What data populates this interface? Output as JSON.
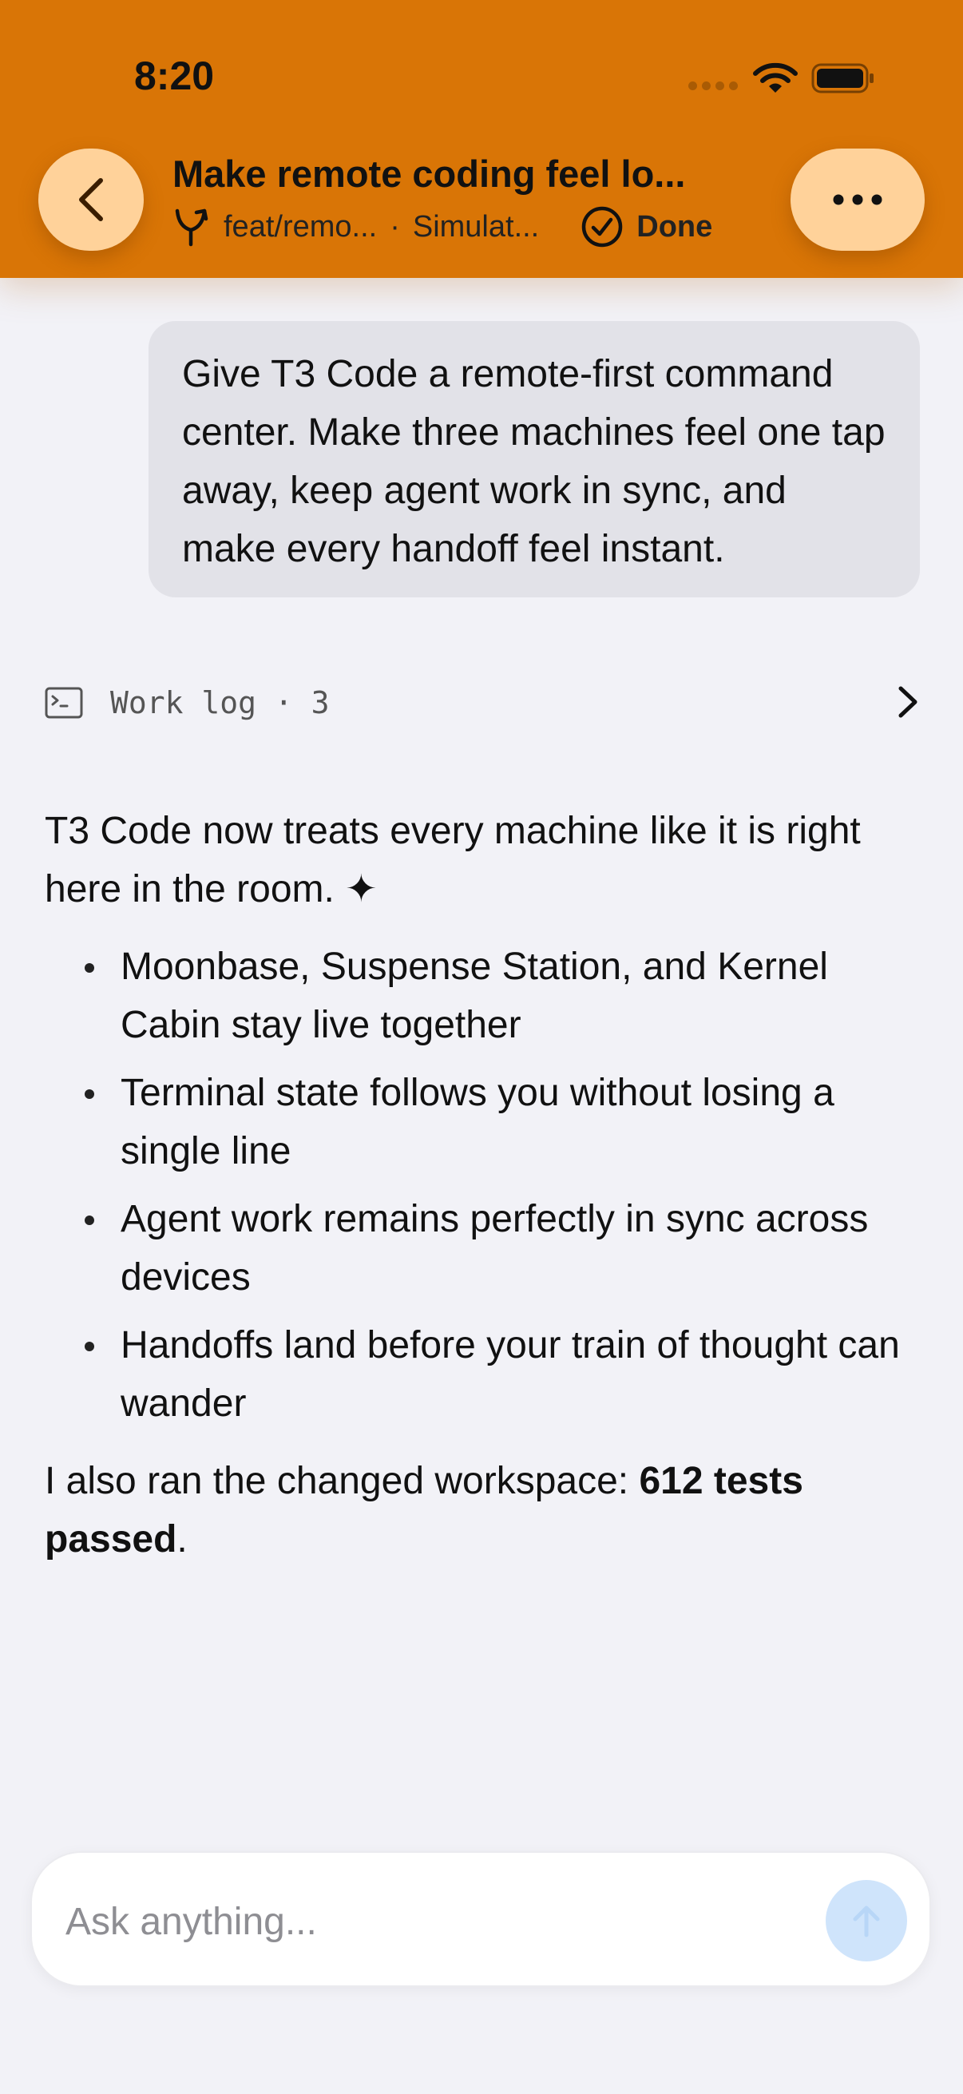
{
  "status_bar": {
    "time": "8:20"
  },
  "header": {
    "title": "Make remote coding feel lo...",
    "branch": "feat/remo...",
    "separator": "·",
    "location": "Simulat...",
    "status": "Done",
    "accent_color": "#d97506",
    "button_color": "#ffd29a"
  },
  "conversation": {
    "user_message": "Give T3 Code a remote-first command center. Make three machines feel one tap away, keep agent work in sync, and make every handoff feel instant.",
    "work_log": {
      "label": "Work log · 3"
    },
    "assistant": {
      "intro": "T3 Code now treats every machine like it is right here in the room. ✦",
      "bullets": [
        "Moonbase, Suspense Station, and Kernel Cabin stay live together",
        "Terminal state follows you without losing a single line",
        "Agent work remains perfectly in sync across devices",
        "Handoffs land before your train of thought can wander"
      ],
      "summary_prefix": "I also ran the changed workspace: ",
      "summary_bold": "612 tests passed",
      "summary_suffix": "."
    }
  },
  "composer": {
    "placeholder": "Ask anything...",
    "value": "",
    "send_color": "#cfe4fb"
  },
  "icons": {
    "back": "chevron-left-icon",
    "more": "ellipsis-icon",
    "branch": "git-branch-icon",
    "done": "check-circle-icon",
    "terminal": "terminal-icon",
    "expand": "chevron-right-icon",
    "send": "arrow-up-icon"
  }
}
